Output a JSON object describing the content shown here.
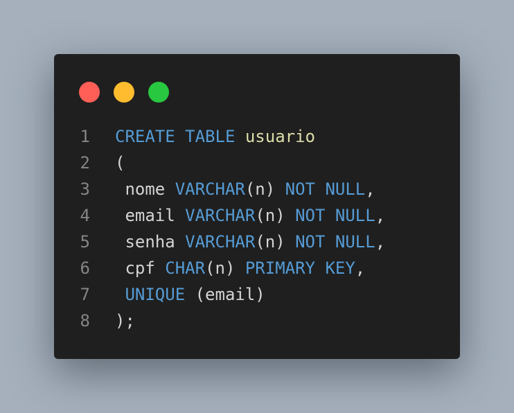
{
  "window": {
    "controls": [
      {
        "name": "close",
        "color": "#ff5f57"
      },
      {
        "name": "minimize",
        "color": "#febc2e"
      },
      {
        "name": "maximize",
        "color": "#28c840"
      }
    ]
  },
  "code": {
    "language": "SQL",
    "lines": [
      {
        "number": "1",
        "tokens": [
          {
            "text": "CREATE TABLE",
            "type": "kw"
          },
          {
            "text": " ",
            "type": "plain"
          },
          {
            "text": "usuario",
            "type": "ident"
          }
        ]
      },
      {
        "number": "2",
        "tokens": [
          {
            "text": "(",
            "type": "plain"
          }
        ]
      },
      {
        "number": "3",
        "tokens": [
          {
            "text": " nome ",
            "type": "plain"
          },
          {
            "text": "VARCHAR",
            "type": "kw"
          },
          {
            "text": "(n) ",
            "type": "plain"
          },
          {
            "text": "NOT NULL",
            "type": "kw"
          },
          {
            "text": ",",
            "type": "plain"
          }
        ]
      },
      {
        "number": "4",
        "tokens": [
          {
            "text": " email ",
            "type": "plain"
          },
          {
            "text": "VARCHAR",
            "type": "kw"
          },
          {
            "text": "(n) ",
            "type": "plain"
          },
          {
            "text": "NOT NULL",
            "type": "kw"
          },
          {
            "text": ",",
            "type": "plain"
          }
        ]
      },
      {
        "number": "5",
        "tokens": [
          {
            "text": " senha ",
            "type": "plain"
          },
          {
            "text": "VARCHAR",
            "type": "kw"
          },
          {
            "text": "(n) ",
            "type": "plain"
          },
          {
            "text": "NOT NULL",
            "type": "kw"
          },
          {
            "text": ",",
            "type": "plain"
          }
        ]
      },
      {
        "number": "6",
        "tokens": [
          {
            "text": " cpf ",
            "type": "plain"
          },
          {
            "text": "CHAR",
            "type": "kw"
          },
          {
            "text": "(n) ",
            "type": "plain"
          },
          {
            "text": "PRIMARY KEY",
            "type": "kw"
          },
          {
            "text": ",",
            "type": "plain"
          }
        ]
      },
      {
        "number": "7",
        "tokens": [
          {
            "text": " ",
            "type": "plain"
          },
          {
            "text": "UNIQUE",
            "type": "kw"
          },
          {
            "text": " (email)",
            "type": "plain"
          }
        ]
      },
      {
        "number": "8",
        "tokens": [
          {
            "text": ");",
            "type": "plain"
          }
        ]
      }
    ]
  },
  "colors": {
    "background": "#a5b0bc",
    "editor_background": "#1f1f1f",
    "keyword": "#569cd6",
    "identifier": "#dcdcaa",
    "text": "#d4d4d4",
    "line_number": "#858585"
  }
}
